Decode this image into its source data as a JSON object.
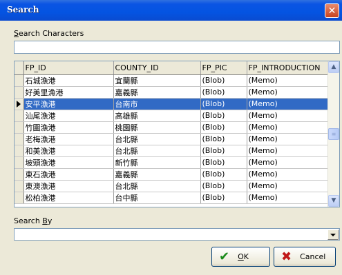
{
  "window": {
    "title": "Search",
    "close_glyph": "✕"
  },
  "search_characters": {
    "label_u": "S",
    "label_rest": "earch Characters",
    "value": ""
  },
  "grid": {
    "columns": [
      "FP_ID",
      "COUNTY_ID",
      "FP_PIC",
      "FP_INTRODUCTION"
    ],
    "selected_index": 2,
    "rows": [
      [
        "石城漁港",
        "宜蘭縣",
        "(Blob)",
        "(Memo)"
      ],
      [
        "好美里漁港",
        "嘉義縣",
        "(Blob)",
        "(Memo)"
      ],
      [
        "安平漁港",
        "台南市",
        "(Blob)",
        "(Memo)"
      ],
      [
        "汕尾漁港",
        "高雄縣",
        "(Blob)",
        "(Memo)"
      ],
      [
        "竹圍漁港",
        "桃園縣",
        "(Blob)",
        "(Memo)"
      ],
      [
        "老梅漁港",
        "台北縣",
        "(Blob)",
        "(Memo)"
      ],
      [
        "和美漁港",
        "台北縣",
        "(Blob)",
        "(Memo)"
      ],
      [
        "坡頭漁港",
        "新竹縣",
        "(Blob)",
        "(Memo)"
      ],
      [
        "東石漁港",
        "嘉義縣",
        "(Blob)",
        "(Memo)"
      ],
      [
        "東澳漁港",
        "台北縣",
        "(Blob)",
        "(Memo)"
      ],
      [
        "松柏漁港",
        "台中縣",
        "(Blob)",
        "(Memo)"
      ]
    ],
    "scroll_up_glyph": "▲",
    "scroll_down_glyph": "▼",
    "thumb_grip_glyph": "≡"
  },
  "search_by": {
    "label_rest_pre": "Search ",
    "label_u": "B",
    "label_rest": "y",
    "value": ""
  },
  "buttons": {
    "ok": {
      "icon": "check-icon",
      "icon_glyph": "✔",
      "label_u": "O",
      "label_rest": "K",
      "icon_color": "#1a8a1a"
    },
    "cancel": {
      "icon": "x-icon",
      "icon_glyph": "✖",
      "label": "Cancel",
      "icon_color": "#c01818"
    }
  }
}
